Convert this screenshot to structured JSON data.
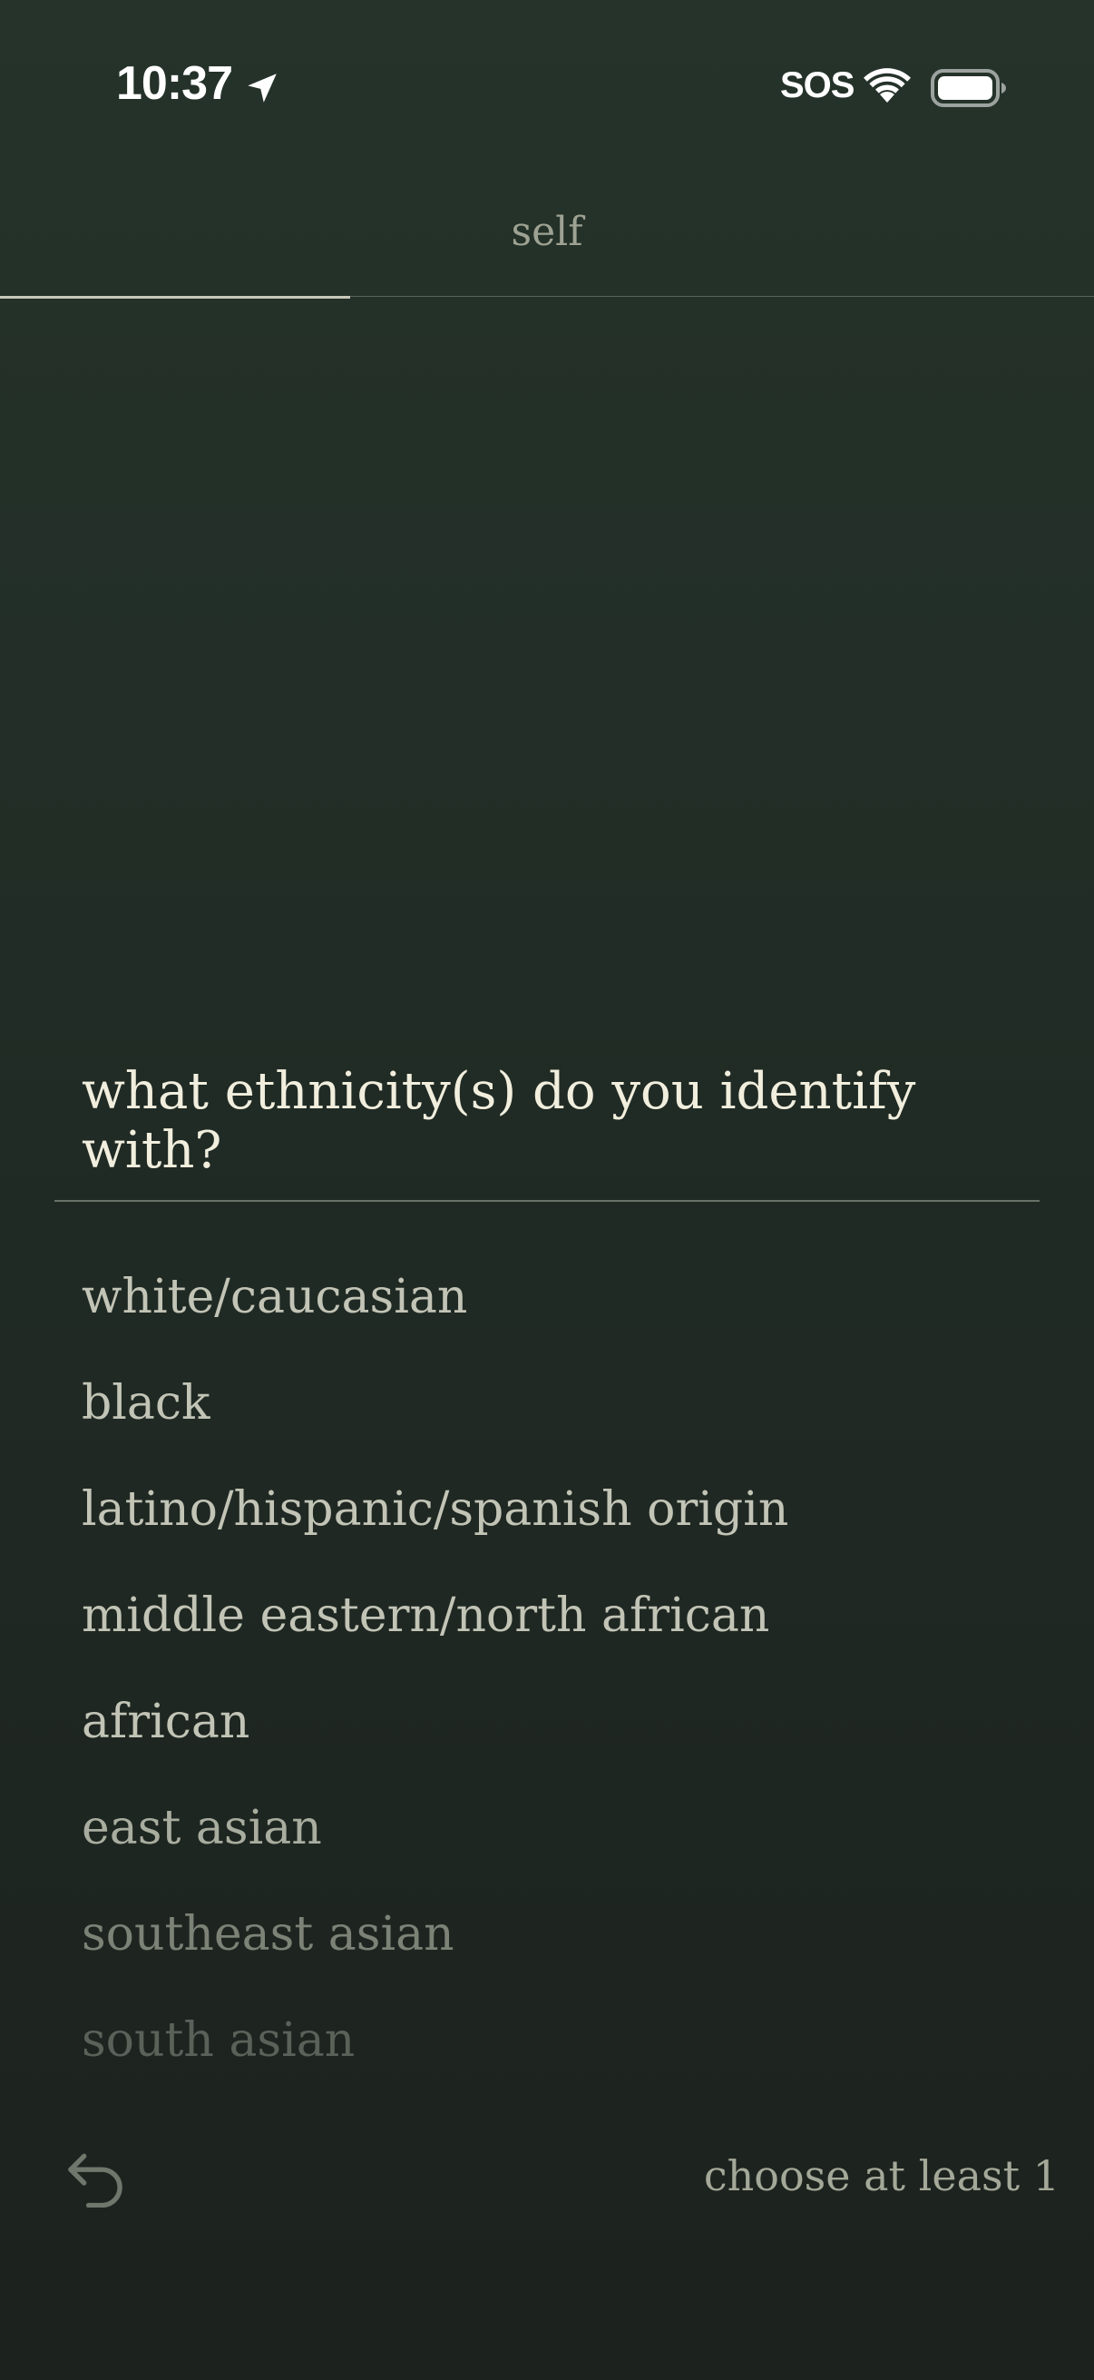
{
  "status_bar": {
    "time": "10:37",
    "sos_label": "SOS",
    "icons": [
      "location-arrow-icon",
      "wifi-icon",
      "battery-icon"
    ]
  },
  "header": {
    "title": "self",
    "progress": 0.32
  },
  "question": {
    "text": "what ethnicity(s) do you identify with?"
  },
  "options": [
    {
      "label": "white/caucasian",
      "color": "#c2c4b6"
    },
    {
      "label": "black",
      "color": "#c2c4b6"
    },
    {
      "label": "latino/hispanic/spanish origin",
      "color": "#c2c4b6"
    },
    {
      "label": "middle eastern/north african",
      "color": "#c2c4b6"
    },
    {
      "label": "african",
      "color": "#c2c4b6"
    },
    {
      "label": "east asian",
      "color": "#a9ad9f"
    },
    {
      "label": "southeast asian",
      "color": "#7c8276"
    },
    {
      "label": "south asian",
      "color": "#596159"
    }
  ],
  "footer": {
    "back_icon": "undo-arrow-icon",
    "hint": "choose at least 1"
  },
  "colors": {
    "background_top": "#25332a",
    "background_bottom": "#1c221e",
    "question_text": "#f1eedd",
    "hint_text": "#a4a898"
  }
}
